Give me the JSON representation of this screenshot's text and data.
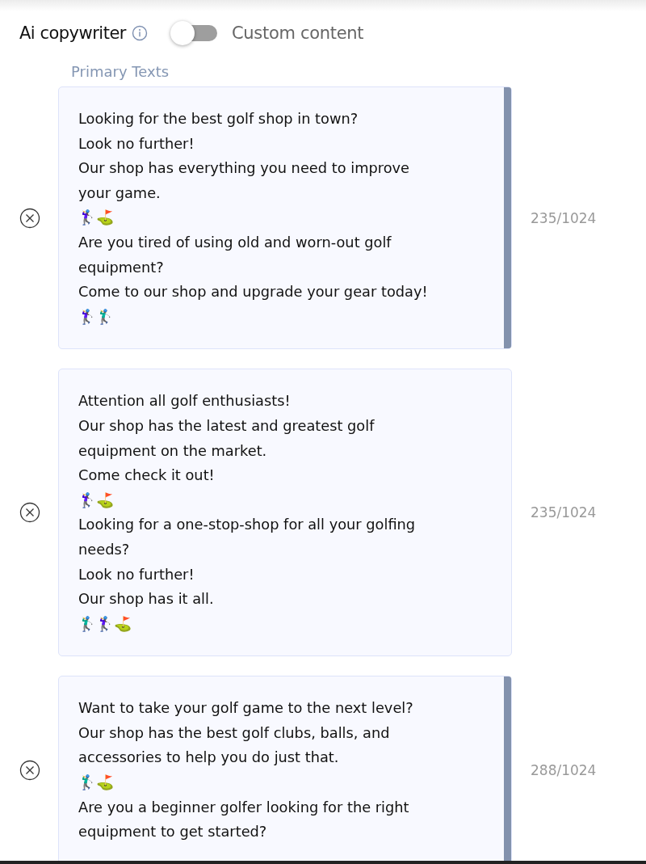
{
  "header": {
    "title": "Ai copywriter",
    "toggle": {
      "on": false
    },
    "toggle_label": "Custom content"
  },
  "section_label": "Primary Texts",
  "texts": [
    {
      "lines": [
        "Looking for the best golf shop in town?",
        "Look no further!",
        "Our shop has everything you need to improve",
        "your game.",
        "🏌️‍♀️⛳",
        "Are you tired of using old and worn-out golf",
        "equipment?",
        "Come to our shop and upgrade your gear today!",
        "🏌️‍♀️🏌️‍♂️"
      ],
      "counter": "235/1024",
      "scrollbar": true
    },
    {
      "lines": [
        "Attention all golf enthusiasts!",
        "Our shop has the latest and greatest golf",
        "equipment on the market.",
        "Come check it out!",
        "🏌️‍♀️⛳",
        "Looking for a one-stop-shop for all your golfing",
        "needs?",
        "Look no further!",
        "Our shop has it all.",
        "🏌️‍♂️🏌️‍♀️⛳"
      ],
      "counter": "235/1024",
      "scrollbar": false
    },
    {
      "lines": [
        "Want to take your golf game to the next level?",
        "Our shop has the best golf clubs, balls, and",
        "accessories to help you do just that.",
        "🏌️‍♂️⛳",
        "Are you a beginner golfer looking for the right",
        "equipment to get started?"
      ],
      "counter": "288/1024",
      "scrollbar": true
    }
  ]
}
